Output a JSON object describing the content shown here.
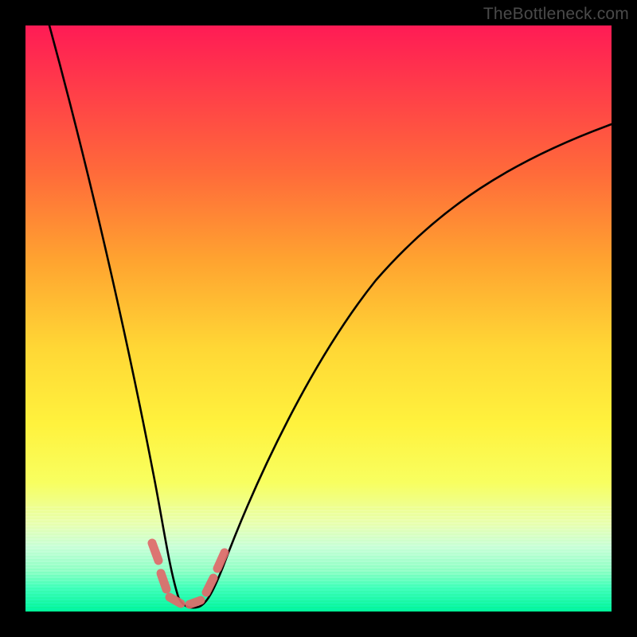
{
  "watermark": "TheBottleneck.com",
  "chart_data": {
    "type": "line",
    "title": "",
    "xlabel": "",
    "ylabel": "",
    "xlim": [
      0,
      100
    ],
    "ylim": [
      0,
      100
    ],
    "series": [
      {
        "name": "curve",
        "x": [
          4,
          8,
          12,
          16,
          20,
          22,
          24,
          26,
          28,
          30,
          32,
          36,
          40,
          45,
          50,
          55,
          60,
          65,
          70,
          75,
          80,
          85,
          90,
          95,
          100
        ],
        "values": [
          100,
          82,
          65,
          49,
          30,
          20,
          9,
          3,
          0.5,
          0.5,
          3,
          12,
          22,
          33,
          43,
          52,
          59,
          65,
          70,
          74,
          77.5,
          80.5,
          83,
          85,
          87
        ]
      }
    ],
    "tolerance_markers": {
      "color": "#e56a6a",
      "points_norm": [
        {
          "x": 0.218,
          "y": 0.108
        },
        {
          "x": 0.232,
          "y": 0.055
        },
        {
          "x": 0.244,
          "y": 0.014
        },
        {
          "x": 0.29,
          "y": 0.01
        },
        {
          "x": 0.312,
          "y": 0.025
        },
        {
          "x": 0.332,
          "y": 0.075
        }
      ]
    },
    "gradient_stops": [
      {
        "pos": 0.0,
        "color": "#ff1b55"
      },
      {
        "pos": 0.55,
        "color": "#ffd735"
      },
      {
        "pos": 0.78,
        "color": "#f8ff60"
      },
      {
        "pos": 1.0,
        "color": "#00f59a"
      }
    ]
  }
}
